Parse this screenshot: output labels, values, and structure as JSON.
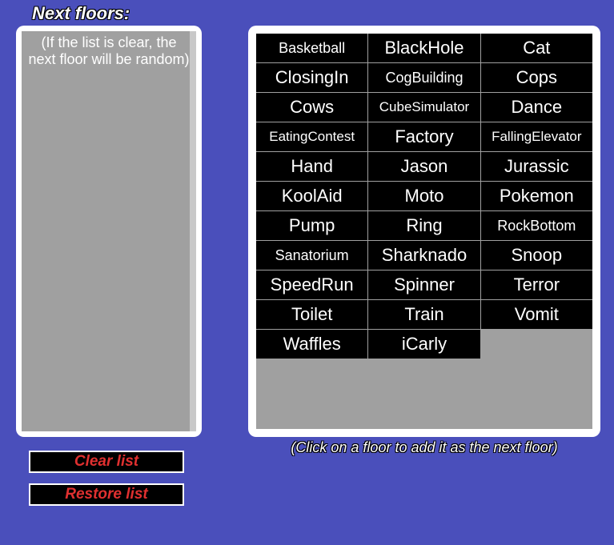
{
  "title": "Next floors:",
  "left_panel": {
    "empty_text": "(If the list is clear, the next floor will be random)"
  },
  "buttons": {
    "clear": "Clear list",
    "restore": "Restore list"
  },
  "hint": "(Click on a floor to add it as the next floor)",
  "floors": [
    "Basketball",
    "BlackHole",
    "Cat",
    "ClosingIn",
    "CogBuilding",
    "Cops",
    "Cows",
    "CubeSimulator",
    "Dance",
    "EatingContest",
    "Factory",
    "FallingElevator",
    "Hand",
    "Jason",
    "Jurassic",
    "KoolAid",
    "Moto",
    "Pokemon",
    "Pump",
    "Ring",
    "RockBottom",
    "Sanatorium",
    "Sharknado",
    "Snoop",
    "SpeedRun",
    "Spinner",
    "Terror",
    "Toilet",
    "Train",
    "Vomit",
    "Waffles",
    "iCarly"
  ]
}
